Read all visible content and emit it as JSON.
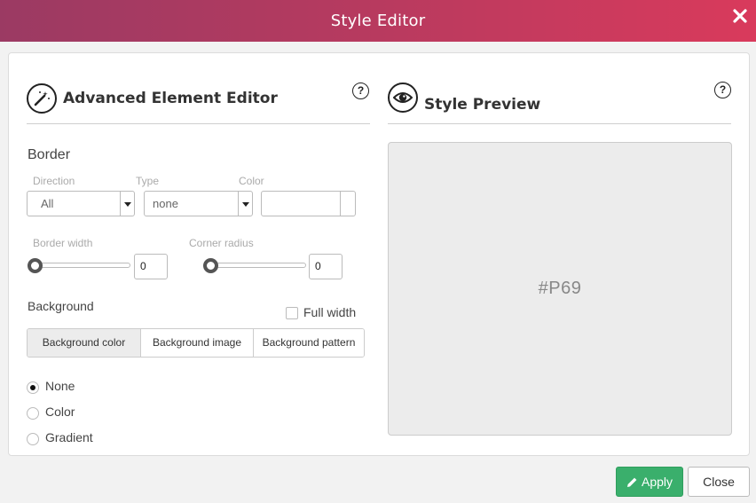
{
  "window": {
    "title": "Style Editor"
  },
  "editor": {
    "title": "Advanced Element Editor",
    "help": "?",
    "border": {
      "heading": "Border",
      "direction": {
        "label": "Direction",
        "value": "All"
      },
      "type": {
        "label": "Type",
        "value": "none"
      },
      "color": {
        "label": "Color",
        "value": ""
      },
      "border_width": {
        "label": "Border width",
        "value": "0"
      },
      "corner_radius": {
        "label": "Corner radius",
        "value": "0"
      }
    },
    "background": {
      "heading": "Background",
      "full_width_label": "Full width",
      "full_width_checked": false,
      "tabs": [
        {
          "label": "Background color",
          "active": true
        },
        {
          "label": "Background image",
          "active": false
        },
        {
          "label": "Background pattern",
          "active": false
        }
      ],
      "options": [
        {
          "label": "None",
          "checked": true
        },
        {
          "label": "Color",
          "checked": false
        },
        {
          "label": "Gradient",
          "checked": false
        }
      ]
    }
  },
  "preview": {
    "title": "Style Preview",
    "help": "?",
    "placeholder": "#P69"
  },
  "footer": {
    "apply_label": "Apply",
    "close_label": "Close"
  },
  "colors": {
    "titlebar_start": "#9b3a63",
    "titlebar_end": "#d93a5c",
    "apply": "#3aaf6c"
  }
}
